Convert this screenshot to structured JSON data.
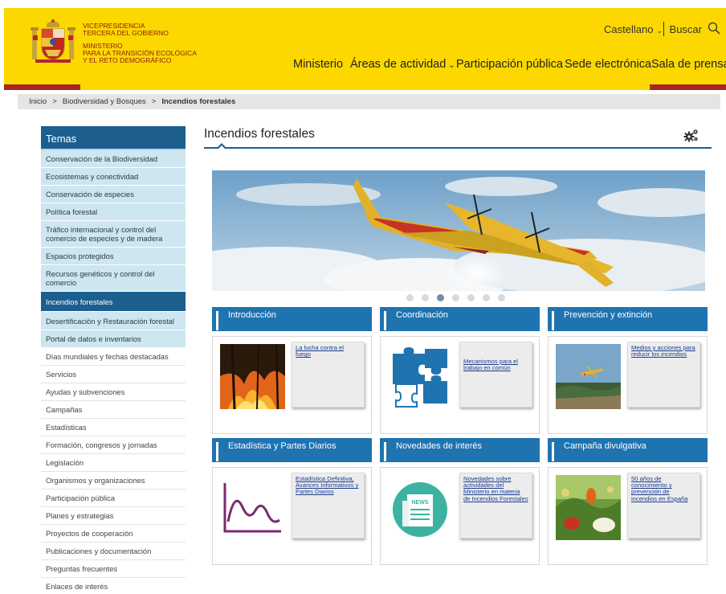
{
  "header": {
    "gov_line1": "VICEPRESIDENCIA",
    "gov_line2": "TERCERA DEL GOBIERNO",
    "min_line1": "MINISTERIO",
    "min_line2": "PARA LA TRANSICIÓN ECOLÓGICA",
    "min_line3": "Y EL RETO DEMOGRÁFICO",
    "language": "Castellano",
    "search_label": "Buscar",
    "nav": [
      "Ministerio",
      "Áreas de actividad",
      "Participación pública",
      "Sede electrónica",
      "Sala de prensa"
    ],
    "accent_yellow": "#fdd800",
    "accent_red": "#a8261d"
  },
  "breadcrumb": {
    "items": [
      "Inicio",
      "Biodiversidad y Bosques",
      "Incendios forestales"
    ],
    "separator": ">"
  },
  "sidebar": {
    "title": "Temas",
    "items": [
      "Conservación de la Biodiversidad",
      "Ecosistemas y conectividad",
      "Conservación de especies",
      "Política forestal",
      "Tráfico internacional y control del comercio de especies y de madera",
      "Espacios protegidos",
      "Recursos genéticos y control del comercio",
      "Incendios forestales",
      "Desertificación y Restauración forestal",
      "Portal de datos e inventarios",
      "Días mundiales y fechas destacadas",
      "Servicios",
      "Ayudas y subvenciones",
      "Campañas",
      "Estadísticas",
      "Formación, congresos y jornadas",
      "Legislación",
      "Organismos y organizaciones",
      "Participación pública",
      "Planes y estrategias",
      "Proyectos de cooperación",
      "Publicaciones y documentación",
      "Preguntas frecuentes",
      "Enlaces de interés"
    ],
    "active_item": "Incendios forestales",
    "accent_blue": "#1c5f8f"
  },
  "main": {
    "title": "Incendios forestales",
    "carousel": {
      "slide_count": 7,
      "active_slide": 3
    },
    "cards": [
      {
        "title": "Introducción",
        "link": "La lucha contra el fuego",
        "icon": "forest-fire-photo"
      },
      {
        "title": "Coordinación",
        "link": "Mecanismos para el trabajo en común",
        "icon": "puzzle-icon"
      },
      {
        "title": "Prevención y extinción",
        "link": "Medios y acciones para reducir los incendios",
        "icon": "seaplane-photo"
      },
      {
        "title": "Estadística y Partes Diarios",
        "link": "Estadística Definitiva, Avances Informativos y Partes Diarios",
        "icon": "line-graph-icon"
      },
      {
        "title": "Novedades de interés",
        "link": "Novedades sobre actividades del Ministerio en materia de Incendios Forestales",
        "icon": "news-icon",
        "icon_text": "NEWS"
      },
      {
        "title": "Campaña divulgativa",
        "link": "50 años de conocimiento y prevención de incendios en España",
        "icon": "campaign-cartoon-photo"
      }
    ]
  }
}
